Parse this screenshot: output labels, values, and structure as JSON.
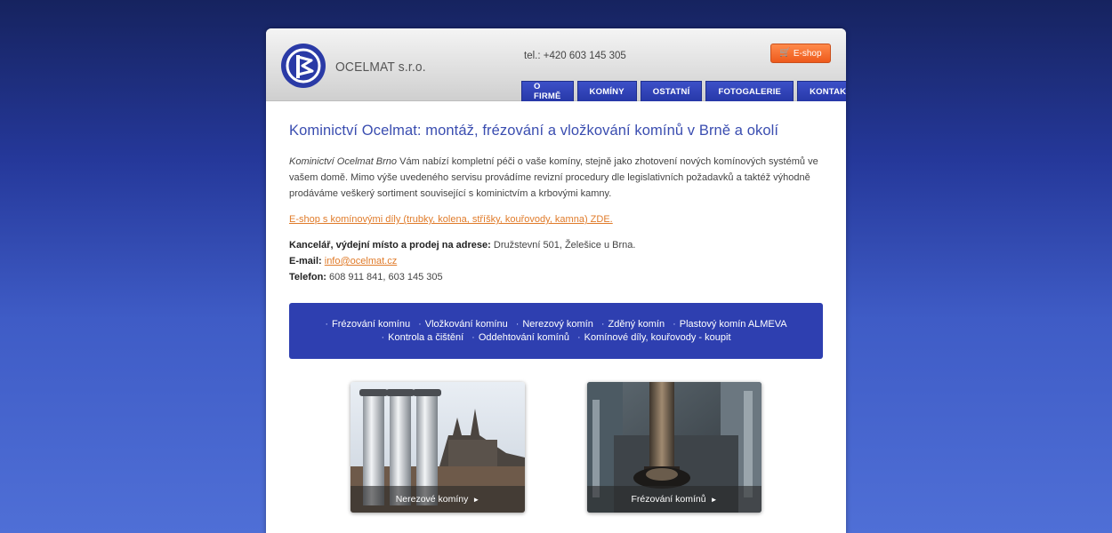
{
  "header": {
    "logo_text": "OCELMAT s.r.o.",
    "phone": "tel.: +420 603 145 305",
    "eshop_label": "E-shop"
  },
  "nav": [
    {
      "label": "O FIRMĚ"
    },
    {
      "label": "KOMÍNY"
    },
    {
      "label": "OSTATNÍ"
    },
    {
      "label": "FOTOGALERIE"
    },
    {
      "label": "KONTAKT"
    }
  ],
  "main": {
    "title": "Kominictví Ocelmat: montáž, frézování a vložkování komínů v Brně a okolí",
    "intro_em": "Kominictví Ocelmat Brno",
    "intro_rest": " Vám nabízí kompletní péči o vaše komíny, stejně jako zhotovení nových komínových systémů ve vašem domě.  Mimo výše uvedeného servisu provádíme revizní procedury dle legislativních požadavků a taktéž výhodně prodáváme veškerý sortiment související s kominictvím a krbovými kamny.",
    "eshop_link": "E-shop s komínovými díly (trubky, kolena, stříšky, kouřovody, kamna) ZDE.",
    "office_label": "Kancelář, výdejní místo a prodej na adrese:",
    "office_value": " Družstevní 501, Želešice u Brna.",
    "email_label": "E-mail:",
    "email_value": "info@ocelmat.cz",
    "phone_label": "Telefon:",
    "phone_value": " 608 911 841,  603 145 305"
  },
  "services": {
    "row1": [
      "Frézování komínu",
      "Vložkování komínu",
      "Nerezový komín",
      "Zděný komín",
      "Plastový komín ALMEVA"
    ],
    "row2": [
      "Kontrola a čištění",
      "Oddehtování komínů",
      "Komínové díly, kouřovody - koupit"
    ]
  },
  "tiles": [
    {
      "caption": "Nerezové komíny"
    },
    {
      "caption": "Frézování komínů"
    }
  ],
  "colors": {
    "accent_blue": "#2e3fb0",
    "link_orange": "#e07b2a",
    "eshop_orange": "#ee5a1c"
  }
}
